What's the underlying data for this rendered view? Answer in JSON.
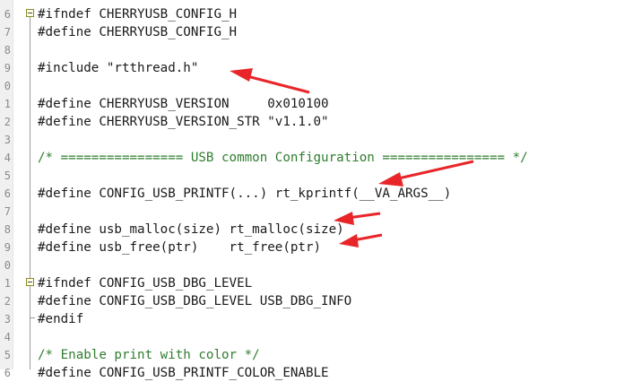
{
  "editor": {
    "lines": [
      {
        "num": "6",
        "text": "#ifndef CHERRYUSB_CONFIG_H",
        "type": "code"
      },
      {
        "num": "7",
        "text": "#define CHERRYUSB_CONFIG_H",
        "type": "code"
      },
      {
        "num": "8",
        "text": "",
        "type": "code"
      },
      {
        "num": "9",
        "text": "#include \"rtthread.h\"",
        "type": "code"
      },
      {
        "num": "0",
        "text": "",
        "type": "code"
      },
      {
        "num": "1",
        "text": "#define CHERRYUSB_VERSION     0x010100",
        "type": "code"
      },
      {
        "num": "2",
        "text": "#define CHERRYUSB_VERSION_STR \"v1.1.0\"",
        "type": "code"
      },
      {
        "num": "3",
        "text": "",
        "type": "code"
      },
      {
        "num": "4",
        "text": "/* ================ USB common Configuration ================ */",
        "type": "comment"
      },
      {
        "num": "5",
        "text": "",
        "type": "code"
      },
      {
        "num": "6",
        "text": "#define CONFIG_USB_PRINTF(...) rt_kprintf(__VA_ARGS__)",
        "type": "code"
      },
      {
        "num": "7",
        "text": "",
        "type": "code"
      },
      {
        "num": "8",
        "text": "#define usb_malloc(size) rt_malloc(size)",
        "type": "code"
      },
      {
        "num": "9",
        "text": "#define usb_free(ptr)    rt_free(ptr)",
        "type": "code"
      },
      {
        "num": "0",
        "text": "",
        "type": "code"
      },
      {
        "num": "1",
        "text": "#ifndef CONFIG_USB_DBG_LEVEL",
        "type": "code"
      },
      {
        "num": "2",
        "text": "#define CONFIG_USB_DBG_LEVEL USB_DBG_INFO",
        "type": "code"
      },
      {
        "num": "3",
        "text": "#endif",
        "type": "code"
      },
      {
        "num": "4",
        "text": "",
        "type": "code"
      },
      {
        "num": "5",
        "text": "/* Enable print with color */",
        "type": "comment"
      },
      {
        "num": "6",
        "text": "#define CONFIG_USB_PRINTF_COLOR_ENABLE",
        "type": "code"
      }
    ]
  },
  "colors": {
    "annotation_arrow": "#e8262a",
    "comment": "#2f7d2f",
    "fold_marker": "#8a8a2a"
  }
}
